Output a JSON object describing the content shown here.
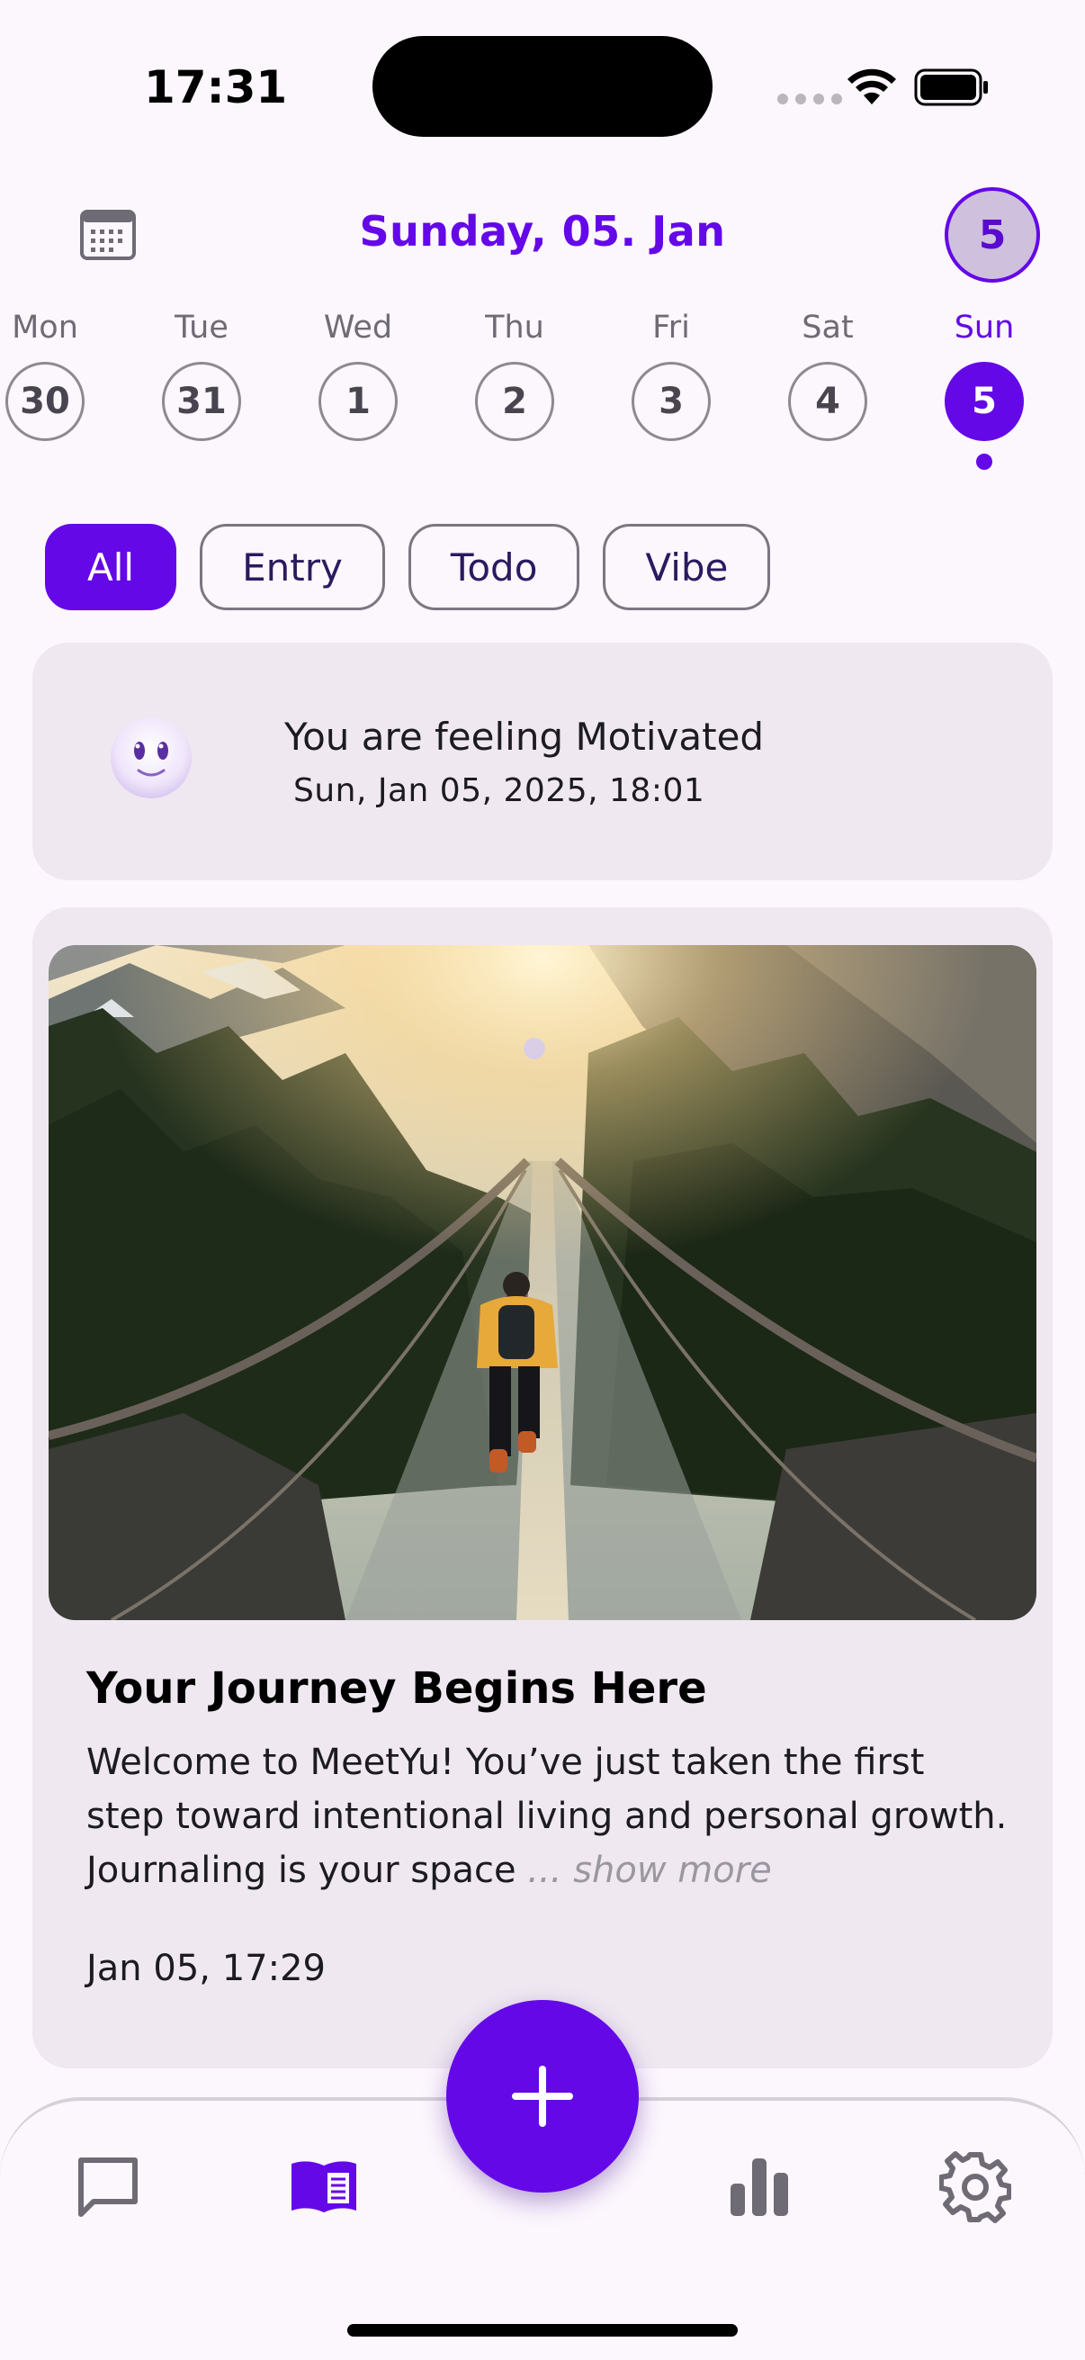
{
  "status_bar": {
    "time": "17:31"
  },
  "header": {
    "title": "Sunday, 05. Jan",
    "day_badge": "5"
  },
  "week": [
    {
      "day": "Mon",
      "date": "30"
    },
    {
      "day": "Tue",
      "date": "31"
    },
    {
      "day": "Wed",
      "date": "1"
    },
    {
      "day": "Thu",
      "date": "2"
    },
    {
      "day": "Fri",
      "date": "3"
    },
    {
      "day": "Sat",
      "date": "4"
    },
    {
      "day": "Sun",
      "date": "5",
      "selected": true
    }
  ],
  "filters": [
    "All",
    "Entry",
    "Todo",
    "Vibe"
  ],
  "mood": {
    "title": "You are feeling Motivated",
    "datetime": "Sun, Jan 05, 2025, 18:01"
  },
  "entry": {
    "title": "Your Journey Begins Here",
    "body": "Welcome to MeetYu! You’ve just taken the first step toward intentional living and personal growth. Journaling is your space",
    "show_more": "... show more",
    "date": "Jan 05, 17:29"
  },
  "colors": {
    "accent": "#6408e8",
    "background": "#fcf6fd",
    "card": "#efe8f1"
  },
  "icons": {
    "header_left": "calendar-icon",
    "nav": [
      "chat-icon",
      "journal-icon",
      "add-icon",
      "stats-icon",
      "settings-icon"
    ]
  }
}
